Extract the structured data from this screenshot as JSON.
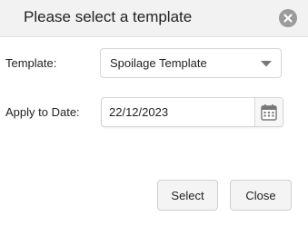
{
  "dialog": {
    "title": "Please select a template",
    "close_icon": "close-circle-icon"
  },
  "form": {
    "template_label": "Template:",
    "template_value": "Spoilage Template",
    "date_label": "Apply to Date:",
    "date_value": "22/12/2023",
    "calendar_icon": "calendar-icon"
  },
  "buttons": {
    "select_label": "Select",
    "close_label": "Close"
  },
  "colors": {
    "header_bg": "#f2f2f2",
    "close_icon_bg": "#9b9b9b",
    "button_bg": "#f4f4f4"
  }
}
